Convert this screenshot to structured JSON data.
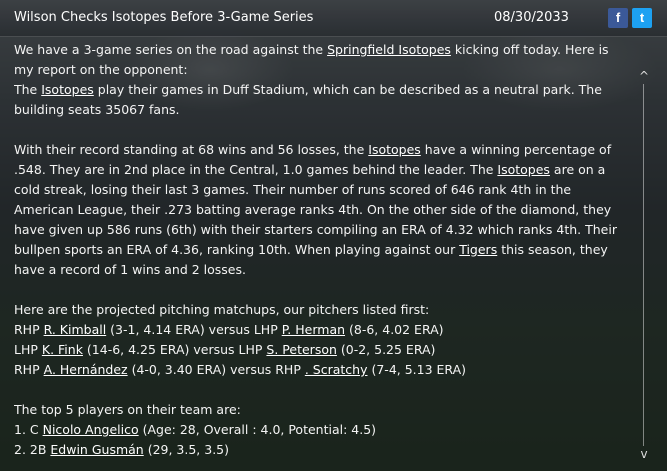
{
  "header": {
    "title": "Wilson Checks Isotopes Before 3-Game Series",
    "date": "08/30/2033",
    "facebook_glyph": "f",
    "twitter_glyph": "t"
  },
  "article": {
    "p1": {
      "t1": "We have a 3-game series on the road against the ",
      "l1": "Springfield Isotopes",
      "t2": " kicking off today. Here is my report on the opponent:"
    },
    "p2": {
      "t1": "The ",
      "l1": "Isotopes",
      "t2": " play their games in Duff Stadium, which can be described as a neutral park. The building seats 35067 fans."
    },
    "p3": {
      "t1": "With their record standing at 68 wins and 56 losses, the ",
      "l1": "Isotopes",
      "t2": " have a winning percentage of .548. They are in 2nd place in the Central, 1.0 games behind the leader. The ",
      "l2": "Isotopes",
      "t3": " are on a cold streak, losing their last 3 games. Their number of runs scored of 646 rank 4th in the American League, their .273 batting average ranks 4th. On the other side of the diamond, they have given up 586 runs (6th) with their starters compiling an ERA of 4.32 which ranks 4th. Their bullpen sports an ERA of 4.36, ranking 10th. When playing against our ",
      "l3": "Tigers",
      "t4": " this season, they have a record of 1 wins and 2 losses."
    },
    "matchups_intro": "Here are the projected pitching matchups, our pitchers listed first:",
    "matchups": [
      {
        "h1": "RHP ",
        "p1": "R. Kimball",
        "s1": " (3-1, 4.14 ERA) versus LHP ",
        "p2": "P. Herman",
        "s2": " (8-6, 4.02 ERA)"
      },
      {
        "h1": "LHP ",
        "p1": "K. Fink",
        "s1": " (14-6, 4.25 ERA) versus LHP ",
        "p2": "S. Peterson",
        "s2": " (0-2, 5.25 ERA)"
      },
      {
        "h1": "RHP ",
        "p1": "A. Hernández",
        "s1": " (4-0, 3.40 ERA) versus RHP ",
        "p2": " . Scratchy",
        "s2": " (7-4, 5.13 ERA)"
      }
    ],
    "top_intro": "The top 5 players on their team are:",
    "top_players": [
      {
        "prefix": "1. C ",
        "name": "Nicolo Angelico",
        "stats": " (Age: 28, Overall : 4.0, Potential: 4.5)"
      },
      {
        "prefix": "2. 2B ",
        "name": "Edwin Gusmán",
        "stats": " (29, 3.5, 3.5)"
      }
    ]
  },
  "scrollbar": {
    "up_glyph": "^",
    "down_glyph": "v"
  }
}
